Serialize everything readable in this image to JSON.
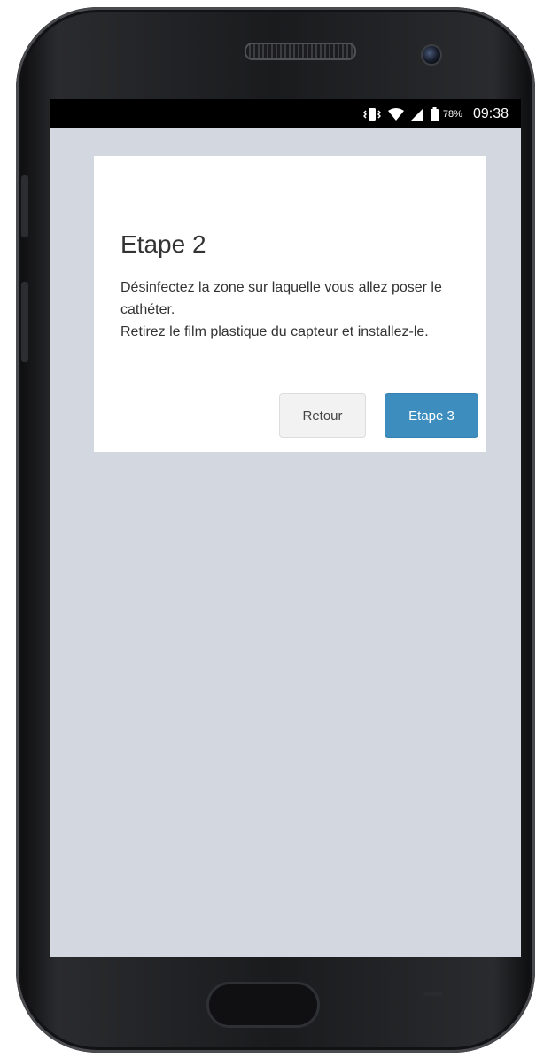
{
  "status_bar": {
    "battery_percent": "78%",
    "time": "09:38"
  },
  "dialog": {
    "title": "Etape 2",
    "body": [
      "Désinfectez la zone sur laquelle vous allez poser le cathéter.",
      "Retirez le film plastique du capteur et installez-le."
    ],
    "back_label": "Retour",
    "next_label": "Etape 3"
  },
  "colors": {
    "screen_background": "#d3d7df",
    "primary_button": "#3d8dbf",
    "secondary_button": "#f2f2f2"
  },
  "icons": [
    "vibrate-icon",
    "wifi-icon",
    "signal-icon",
    "battery-icon"
  ]
}
